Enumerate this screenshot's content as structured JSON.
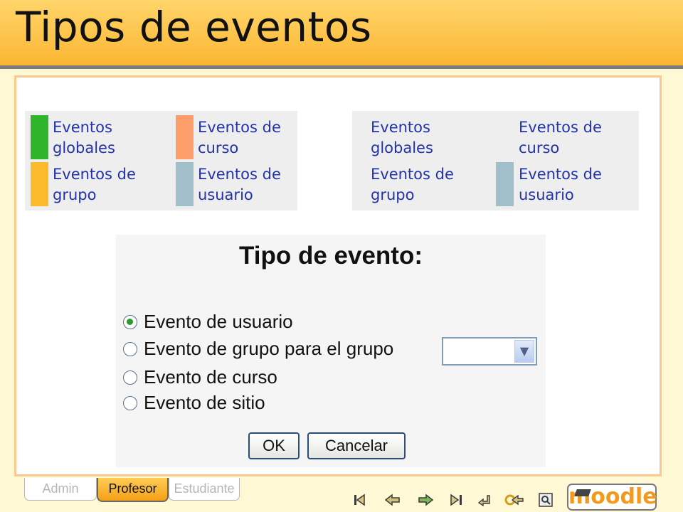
{
  "title": "Tipos de eventos",
  "legend_left": {
    "items": [
      {
        "label": "Eventos\nglobales",
        "color": "#2eb52c"
      },
      {
        "label": "Eventos de\ncurso",
        "color": "#fd9d6a"
      },
      {
        "label": "Eventos de\ngrupo",
        "color": "#fbbb2b"
      },
      {
        "label": "Eventos de\nusuario",
        "color": "#a1bfcb"
      }
    ]
  },
  "legend_right": {
    "items": [
      {
        "label": "Eventos\nglobales",
        "color": ""
      },
      {
        "label": "Eventos de\ncurso",
        "color": ""
      },
      {
        "label": "Eventos de\ngrupo",
        "color": ""
      },
      {
        "label": "Eventos de\nusuario",
        "color": "#a1bfcb"
      }
    ]
  },
  "form": {
    "heading": "Tipo de evento:",
    "options": [
      {
        "label": "Evento de usuario",
        "checked": true
      },
      {
        "label": "Evento de grupo para el grupo",
        "checked": false
      },
      {
        "label": "Evento de curso",
        "checked": false
      },
      {
        "label": "Evento de sitio",
        "checked": false
      }
    ],
    "group_select_value": "",
    "ok_label": "OK",
    "cancel_label": "Cancelar"
  },
  "tabs": [
    {
      "label": "Admin",
      "active": false
    },
    {
      "label": "Profesor",
      "active": true
    },
    {
      "label": "Estudiante",
      "active": false
    }
  ],
  "nav_icons": [
    "first-slide-icon",
    "previous-slide-icon",
    "next-slide-icon",
    "last-slide-icon",
    "return-icon",
    "back-to-start-icon",
    "search-icon"
  ],
  "logo_text": "moodle",
  "colors": {
    "accent": "#fbb632",
    "link": "#2233aa",
    "selected_radio": "#2a9d2a"
  }
}
